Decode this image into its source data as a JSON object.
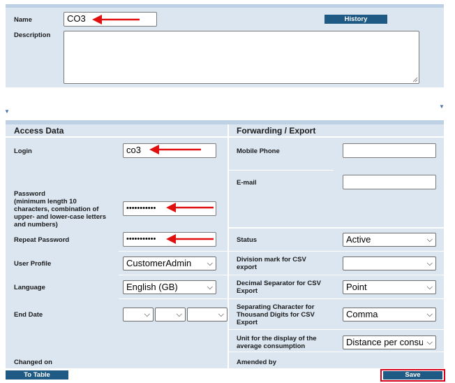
{
  "top": {
    "name_label": "Name",
    "name_value": "CO3",
    "description_label": "Description",
    "history_button": "History"
  },
  "access": {
    "title": "Access Data",
    "login_label": "Login",
    "login_value": "co3",
    "password_label_1": "Password",
    "password_label_2": "(minimum length 10",
    "password_label_3": "characters, combination of",
    "password_label_4": "upper- and lower-case letters",
    "password_label_5": "and numbers)",
    "password_value": "•••••••••••",
    "repeat_password_label": "Repeat Password",
    "repeat_password_value": "•••••••••••",
    "user_profile_label": "User Profile",
    "user_profile_value": "CustomerAdmin",
    "language_label": "Language",
    "language_value": "English (GB)",
    "end_date_label": "End Date",
    "changed_on_label": "Changed on"
  },
  "forwarding": {
    "title": "Forwarding / Export",
    "mobile_label": "Mobile Phone",
    "email_label": "E-mail",
    "status_label": "Status",
    "status_value": "Active",
    "division_label_1": "Division mark for CSV",
    "division_label_2": "export",
    "decimal_label_1": "Decimal Separator for CSV",
    "decimal_label_2": "Export",
    "decimal_value": "Point",
    "thousand_label_1": "Separating Character for",
    "thousand_label_2": "Thousand Digits for CSV",
    "thousand_label_3": "Export",
    "thousand_value": "Comma",
    "unit_label_1": "Unit for the display of the",
    "unit_label_2": "average consumption",
    "unit_value": "Distance per consumption",
    "amended_by_label": "Amended by"
  },
  "buttons": {
    "to_table": "To Table",
    "save": "Save"
  },
  "icons": {
    "chevron": "chevron-down-icon",
    "arrow": "red-arrow-annotation"
  },
  "colors": {
    "panel": "#dbe6f1",
    "topbar": "#bed0e4",
    "button": "#1f5a85",
    "highlight": "#d9001b"
  }
}
